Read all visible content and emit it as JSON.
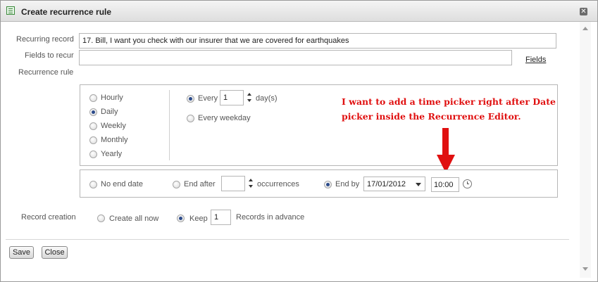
{
  "dialog": {
    "title": "Create recurrence rule",
    "close_glyph": "✕"
  },
  "form": {
    "recurring_record_label": "Recurring record",
    "recurring_record_value": "17. Bill, I want you check with our insurer that we are covered for earthquakes",
    "fields_to_recur_label": "Fields to recur",
    "fields_to_recur_value": "",
    "fields_link": "Fields",
    "recurrence_rule_label": "Recurrence rule"
  },
  "frequency": {
    "options": [
      "Hourly",
      "Daily",
      "Weekly",
      "Monthly",
      "Yearly"
    ],
    "selected": "Daily"
  },
  "interval": {
    "every_label": "Every",
    "every_value": "1",
    "unit_label": "day(s)",
    "every_weekday_label": "Every weekday",
    "selected": "Every"
  },
  "end": {
    "no_end_label": "No end date",
    "end_after_label": "End after",
    "occurrences_value": "",
    "occurrences_label": "occurrences",
    "end_by_label": "End by",
    "end_by_date": "17/01/2012",
    "end_by_time": "10:00",
    "selected": "End by"
  },
  "creation": {
    "label": "Record creation",
    "create_all_label": "Create all now",
    "keep_label": "Keep",
    "keep_value": "1",
    "records_label": "Records in advance",
    "selected": "Keep"
  },
  "annotation": {
    "line1": "I want to add a time picker right after Date",
    "line2": "picker inside the Recurrence Editor.",
    "color": "#e01010"
  },
  "buttons": {
    "save": "Save",
    "close": "Close"
  },
  "icons": [
    "dialog-icon",
    "close-icon",
    "spinner-icon",
    "dropdown-arrow-icon",
    "clock-icon",
    "red-arrow-icon"
  ]
}
